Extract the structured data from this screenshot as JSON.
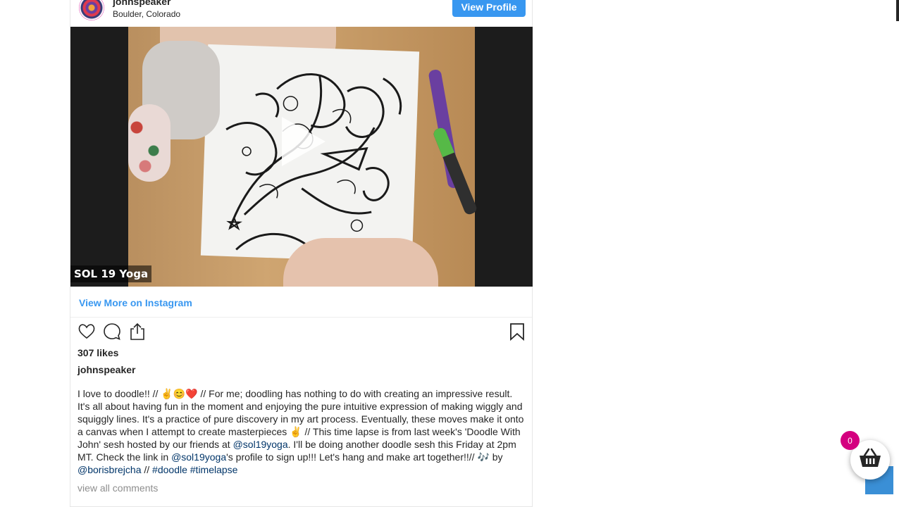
{
  "post": {
    "username": "johnspeaker",
    "location": "Boulder, Colorado",
    "view_profile_label": "View Profile",
    "watermark": "SOL 19 Yoga",
    "view_more_label": "View More on Instagram",
    "likes": "307 likes",
    "caption_user": "johnspeaker",
    "caption": {
      "part1": "I love to doodle!! // ✌️😊❤️ // For me; doodling has nothing to do with creating an impressive result. It's all about having fun in the moment and enjoying the pure intuitive expression of making wiggly and squiggly lines. It's a practice of pure discovery in my art process. Eventually, these moves make it onto a canvas when I attempt to create masterpieces ✌️ // This time lapse is from last week's 'Doodle With John' sesh hosted by our friends at ",
      "mention1": "@sol19yoga",
      "part2": ". I'll be doing another doodle sesh this Friday at 2pm MT. Check the link in ",
      "mention2": "@sol19yoga",
      "part3": "'s profile to sign up!!! Let's hang and make art together!!// 🎶 by ",
      "mention3": "@borisbrejcha",
      "part4": " // ",
      "hashtag1": "#doodle",
      "hashtag2": "#timelapse"
    },
    "view_comments": "view all comments"
  },
  "icons": {
    "like": "heart-icon",
    "comment": "comment-icon",
    "share": "share-icon",
    "save": "bookmark-icon",
    "play": "play-icon",
    "cart": "basket-icon"
  },
  "cart": {
    "count": "0"
  },
  "colors": {
    "accent": "#3897f0",
    "cart_badge": "#d4007f",
    "scroll_top": "#3a8fd6"
  }
}
